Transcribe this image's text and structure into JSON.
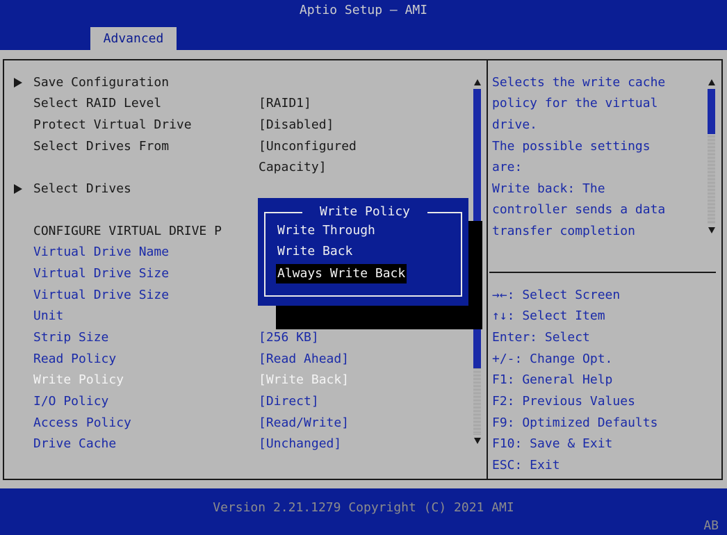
{
  "header": {
    "title": "Aptio Setup – AMI",
    "tab": "Advanced"
  },
  "settings": [
    {
      "label": "Save Configuration",
      "value": "",
      "submenu": true,
      "color": "black"
    },
    {
      "label": "Select RAID Level",
      "value": "[RAID1]",
      "color": "black"
    },
    {
      "label": "Protect Virtual Drive",
      "value": "[Disabled]",
      "color": "black"
    },
    {
      "label": "Select Drives From",
      "value": "[Unconfigured",
      "value2": "Capacity]",
      "color": "black"
    },
    {
      "label": "Select Drives",
      "value": "",
      "submenu": true,
      "color": "black"
    },
    {
      "label": "CONFIGURE VIRTUAL DRIVE P",
      "value": "",
      "color": "black"
    },
    {
      "label": "Virtual Drive Name",
      "value": "",
      "color": "blue"
    },
    {
      "label": "Virtual Drive Size",
      "value": "",
      "color": "blue"
    },
    {
      "label": "Virtual Drive Size",
      "value": "",
      "color": "blue"
    },
    {
      "label": "Unit",
      "value": "",
      "color": "blue"
    },
    {
      "label": "Strip Size",
      "value": "[256 KB]",
      "color": "blue"
    },
    {
      "label": "Read Policy",
      "value": "[Read Ahead]",
      "color": "blue"
    },
    {
      "label": "Write Policy",
      "value": "[Write Back]",
      "color": "white",
      "selected": true
    },
    {
      "label": "I/O Policy",
      "value": "[Direct]",
      "color": "blue"
    },
    {
      "label": "Access Policy",
      "value": "[Read/Write]",
      "color": "blue"
    },
    {
      "label": "Drive Cache",
      "value": "[Unchanged]",
      "color": "blue"
    }
  ],
  "help": {
    "lines": [
      "Selects the write cache",
      "policy for the virtual",
      "drive.",
      "The possible settings",
      "are:",
      "Write back: The",
      "controller sends a data",
      "transfer completion"
    ]
  },
  "keys": [
    "→←: Select Screen",
    "↑↓: Select Item",
    "Enter: Select",
    "+/-: Change Opt.",
    "F1: General Help",
    "F2: Previous Values",
    "F9: Optimized Defaults",
    "F10: Save & Exit",
    "ESC: Exit"
  ],
  "popup": {
    "title": "Write Policy",
    "options": [
      "Write Through",
      "Write Back",
      "Always Write Back"
    ],
    "selected_index": 2
  },
  "footer": {
    "version": "Version 2.21.1279 Copyright (C) 2021 AMI",
    "corner": "AB"
  },
  "colors": {
    "bar_blue": "#0b1e94",
    "background_gray": "#b8b8b8",
    "item_blue": "#1a2aa8"
  }
}
